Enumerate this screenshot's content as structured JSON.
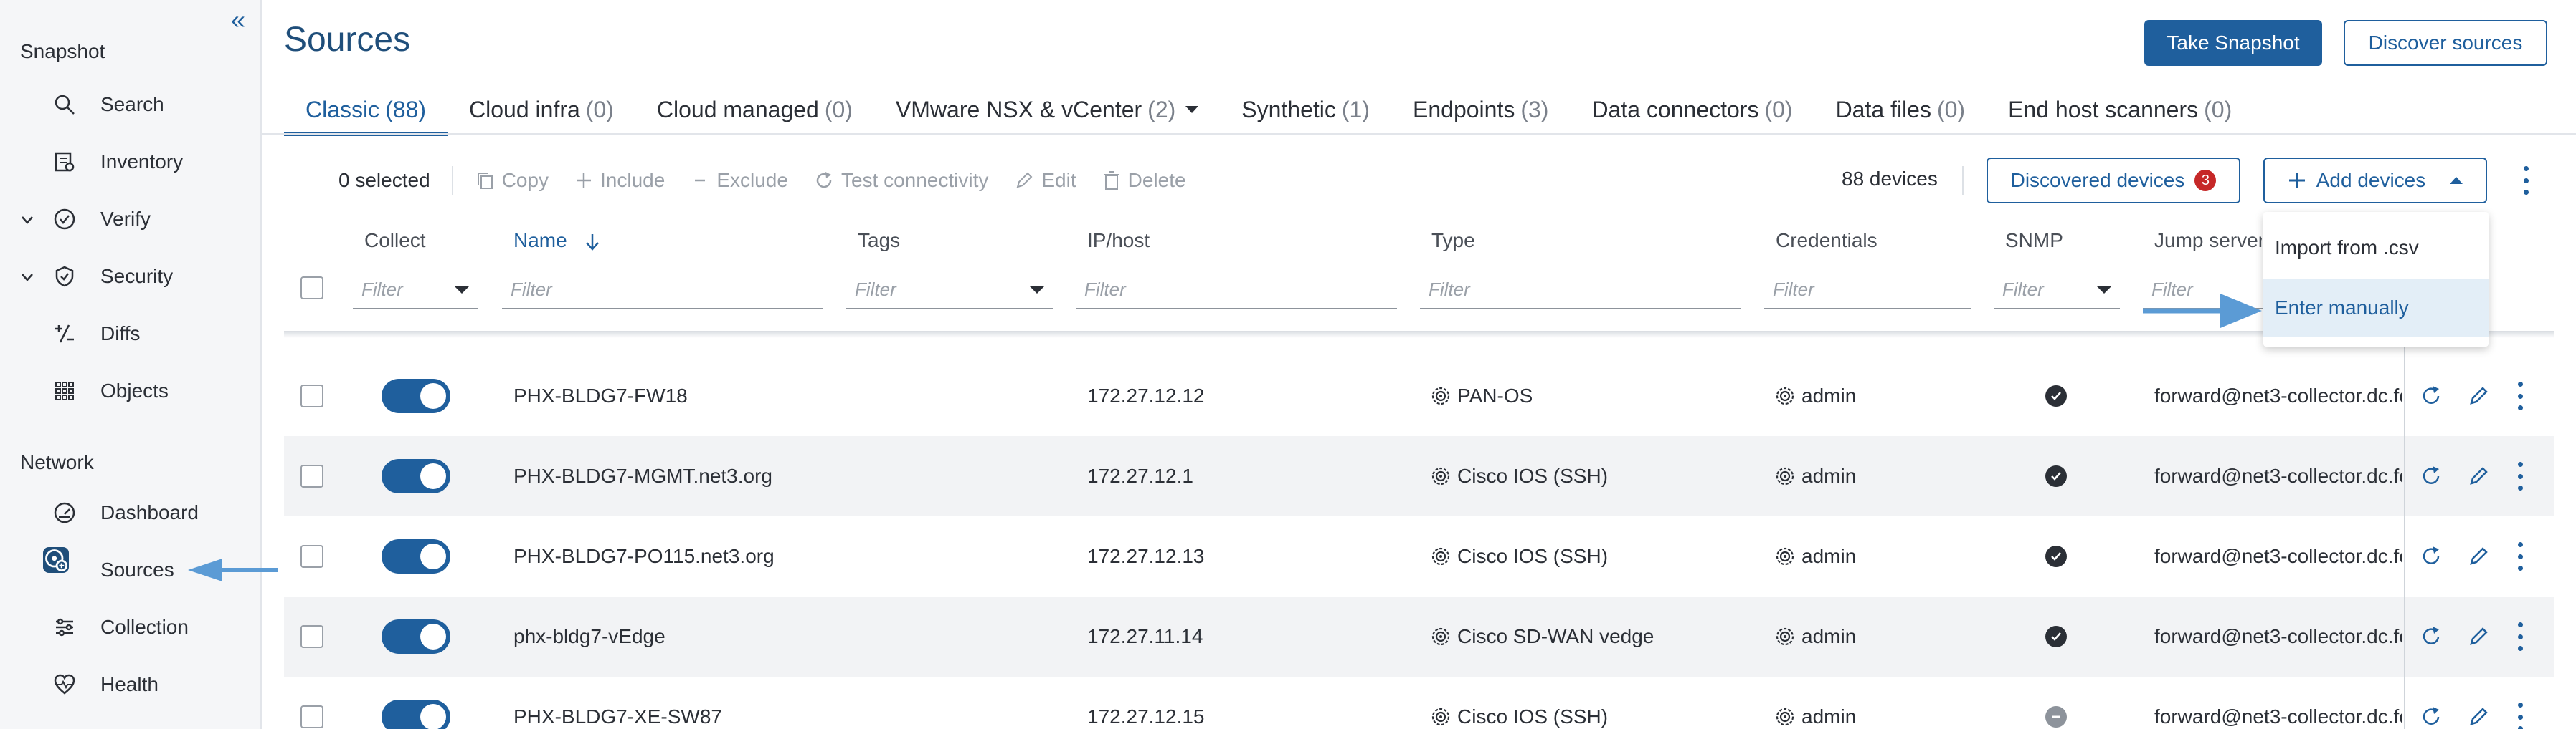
{
  "sidebar": {
    "sections": {
      "snapshot": "Snapshot",
      "network": "Network"
    },
    "items": {
      "search": "Search",
      "inventory": "Inventory",
      "verify": "Verify",
      "security": "Security",
      "diffs": "Diffs",
      "objects": "Objects",
      "dashboard": "Dashboard",
      "sources": "Sources",
      "collection": "Collection",
      "health": "Health"
    }
  },
  "header": {
    "title": "Sources",
    "take_snapshot": "Take Snapshot",
    "discover_sources": "Discover sources"
  },
  "tabs": [
    {
      "label": "Classic",
      "count": "(88)"
    },
    {
      "label": "Cloud infra",
      "count": "(0)"
    },
    {
      "label": "Cloud managed",
      "count": "(0)"
    },
    {
      "label": "VMware NSX & vCenter",
      "count": "(2)"
    },
    {
      "label": "Synthetic",
      "count": "(1)"
    },
    {
      "label": "Endpoints",
      "count": "(3)"
    },
    {
      "label": "Data connectors",
      "count": "(0)"
    },
    {
      "label": "Data files",
      "count": "(0)"
    },
    {
      "label": "End host scanners",
      "count": "(0)"
    }
  ],
  "toolbar": {
    "selected": "0 selected",
    "copy": "Copy",
    "include": "Include",
    "exclude": "Exclude",
    "test": "Test connectivity",
    "edit": "Edit",
    "delete": "Delete",
    "device_count": "88 devices",
    "discovered": "Discovered devices",
    "discovered_badge": "3",
    "add_devices": "Add devices"
  },
  "columns": {
    "collect": "Collect",
    "name": "Name",
    "tags": "Tags",
    "ip": "IP/host",
    "type": "Type",
    "credentials": "Credentials",
    "snmp": "SNMP",
    "jump": "Jump server",
    "filter_placeholder": "Filter"
  },
  "rows": [
    {
      "name": "PHX-BLDG7-FW18",
      "ip": "172.27.12.12",
      "type": "PAN-OS",
      "cred": "admin",
      "snmp": "ok",
      "jump": "forward@net3-collector.dc.fo"
    },
    {
      "name": "PHX-BLDG7-MGMT.net3.org",
      "ip": "172.27.12.1",
      "type": "Cisco IOS (SSH)",
      "cred": "admin",
      "snmp": "ok",
      "jump": "forward@net3-collector.dc.fo"
    },
    {
      "name": "PHX-BLDG7-PO115.net3.org",
      "ip": "172.27.12.13",
      "type": "Cisco IOS (SSH)",
      "cred": "admin",
      "snmp": "ok",
      "jump": "forward@net3-collector.dc.fo"
    },
    {
      "name": "phx-bldg7-vEdge",
      "ip": "172.27.11.14",
      "type": "Cisco SD-WAN vedge",
      "cred": "admin",
      "snmp": "ok",
      "jump": "forward@net3-collector.dc.fo"
    },
    {
      "name": "PHX-BLDG7-XE-SW87",
      "ip": "172.27.12.15",
      "type": "Cisco IOS (SSH)",
      "cred": "admin",
      "snmp": "na",
      "jump": "forward@net3-collector.dc.fo"
    }
  ],
  "dropdown": {
    "import_csv": "Import from .csv",
    "enter_manually": "Enter manually"
  },
  "colors": {
    "primary": "#1f5f9d",
    "title": "#1f4e7a",
    "arrow": "#5b9bd5",
    "badge": "#c62828"
  }
}
